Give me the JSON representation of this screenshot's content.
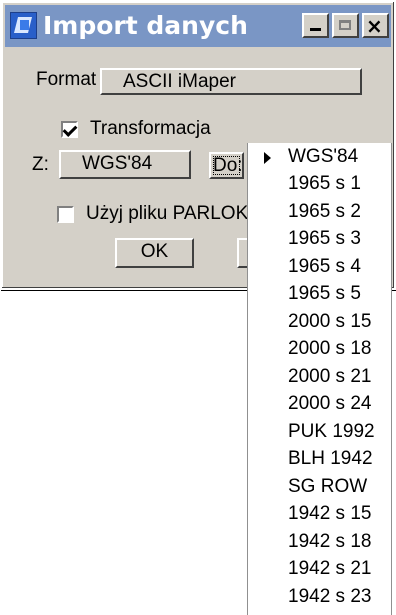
{
  "window": {
    "title": "Import danych",
    "controls": {
      "minimize": "_",
      "maximize": "□",
      "close": "×"
    }
  },
  "form": {
    "format_label": "Format",
    "format_value": "ASCII iMaper",
    "transform_label": "Transformacja",
    "transform_checked": true,
    "source_label": "Z:",
    "source_value": "WGS'84",
    "destination_label": "Do:",
    "parlok_label": "Użyj pliku PARLOK",
    "parlok_checked": false,
    "ok_label": "OK"
  },
  "destination_dropdown": {
    "selected_value": "WGS'84",
    "items": [
      "WGS'84",
      "1965 s 1",
      "1965 s 2",
      "1965 s 3",
      "1965 s 4",
      "1965 s 5",
      "2000 s 15",
      "2000 s 18",
      "2000 s 21",
      "2000 s 24",
      "PUK 1992",
      "BLH 1942",
      "SG ROW",
      "1942 s 15",
      "1942 s 18",
      "1942 s 21",
      "1942 s 23"
    ]
  },
  "icons": {
    "app": "import-map-icon",
    "checkbox_checked": "check-icon",
    "dropdown_selected": "selected-arrow-icon"
  },
  "colors": {
    "title_bar": "#7a96c5",
    "dialog_face": "#d4d0c8",
    "list_background": "#ffffff",
    "text": "#000000"
  }
}
